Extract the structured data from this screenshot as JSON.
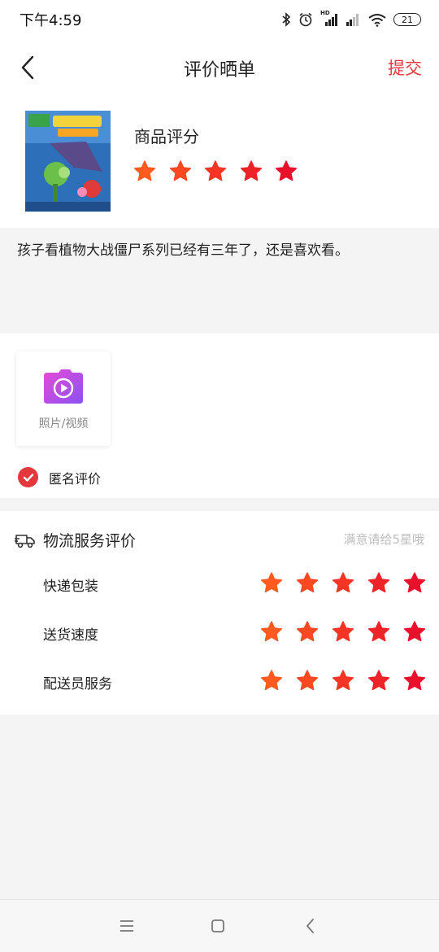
{
  "status_bar": {
    "time": "下午4:59",
    "network_badge": "HD",
    "battery": "21"
  },
  "header": {
    "title": "评价晒单",
    "submit_label": "提交"
  },
  "product": {
    "rating_title": "商品评分",
    "rating": 5,
    "max_rating": 5
  },
  "review": {
    "text": "孩子看植物大战僵尸系列已经有三年了，还是喜欢看。"
  },
  "media": {
    "upload_label": "照片/视频"
  },
  "anonymous": {
    "label": "匿名评价",
    "checked": true
  },
  "logistics": {
    "title": "物流服务评价",
    "hint": "满意请给5星哦",
    "items": [
      {
        "label": "快递包装",
        "rating": 5
      },
      {
        "label": "送货速度",
        "rating": 5
      },
      {
        "label": "配送员服务",
        "rating": 5
      }
    ]
  },
  "colors": {
    "accent": "#e4393c",
    "star_light": "#ff5a1f",
    "star_dark": "#e8102a"
  }
}
